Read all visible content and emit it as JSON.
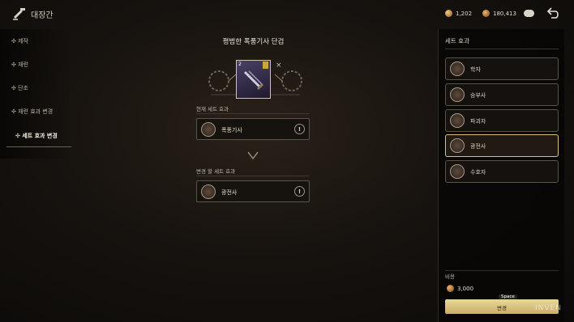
{
  "header": {
    "title": "대장간",
    "currency_1": "1,202",
    "currency_2": "180,413"
  },
  "left_menu": {
    "items": [
      {
        "label": "✣ 제작"
      },
      {
        "label": "✣ 재련"
      },
      {
        "label": "✣ 단조"
      },
      {
        "label": "✣ 재련 효과 변경"
      },
      {
        "label": "✣ 세트 효과 변경"
      }
    ],
    "active_index": 4
  },
  "item": {
    "name": "평범한 폭풍기사 단검",
    "level": "2",
    "close": "×"
  },
  "current_set": {
    "label": "현재 세트 효과",
    "value": "폭풍기사",
    "info": "!"
  },
  "new_set": {
    "label": "변경 할 세트 효과",
    "value": "광전사",
    "info": "!"
  },
  "set_panel": {
    "title": "세트 효과",
    "effects": [
      {
        "label": "학자"
      },
      {
        "label": "승부사"
      },
      {
        "label": "파괴자"
      },
      {
        "label": "광전사"
      },
      {
        "label": "수호자"
      }
    ],
    "selected_index": 3
  },
  "cost": {
    "label": "비용",
    "value": "3,000"
  },
  "apply": {
    "key": "Space",
    "label": "변경"
  },
  "watermark": "INVEN",
  "colors": {
    "accent_gold": "#d9c185",
    "button_gold": "#e3cf8d"
  }
}
